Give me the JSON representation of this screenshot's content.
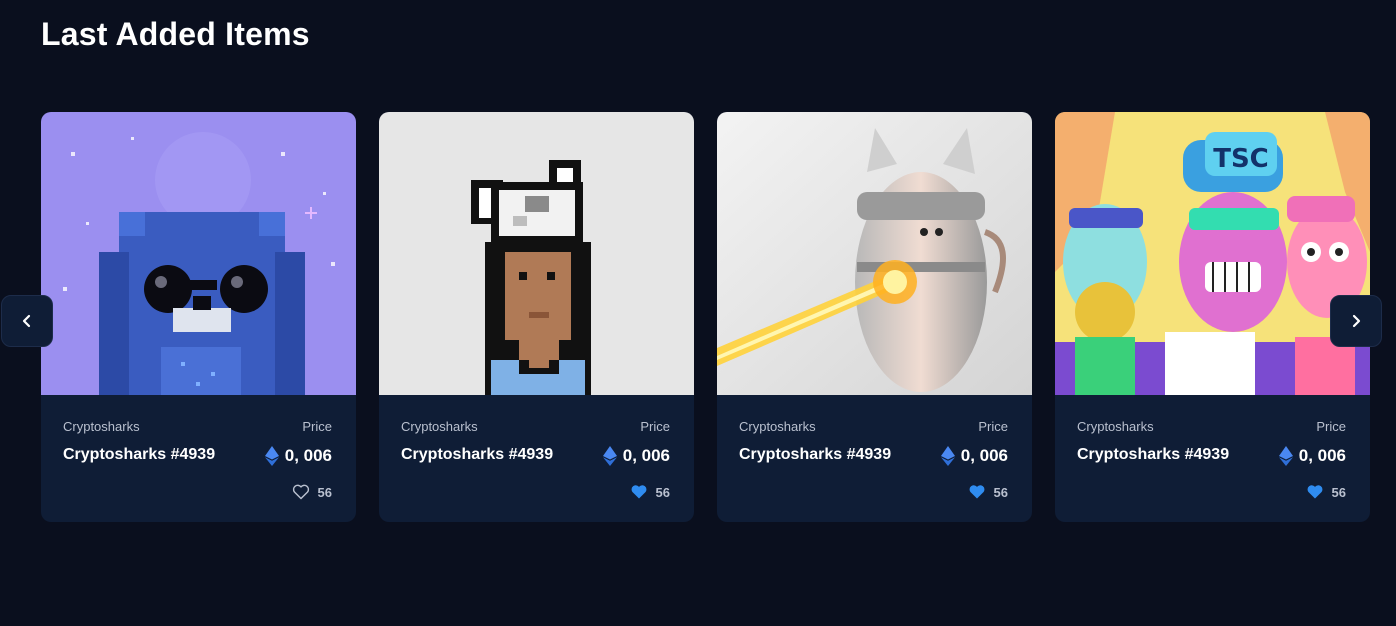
{
  "section": {
    "title": "Last Added Items"
  },
  "carousel": {
    "prev_icon": "chevron-left-icon",
    "next_icon": "chevron-right-icon",
    "cards": [
      {
        "collection": "Cryptosharks",
        "price_label": "Price",
        "name": "Cryptosharks #4939",
        "price": "0, 006",
        "currency_icon": "ethereum-icon",
        "likes": "56",
        "liked": false,
        "art": "purple-owl-pixel-art"
      },
      {
        "collection": "Cryptosharks",
        "price_label": "Price",
        "name": "Cryptosharks #4939",
        "price": "0, 006",
        "currency_icon": "ethereum-icon",
        "likes": "56",
        "liked": true,
        "art": "pixel-girl-with-cat-hat"
      },
      {
        "collection": "Cryptosharks",
        "price_label": "Price",
        "name": "Cryptosharks #4939",
        "price": "0, 006",
        "currency_icon": "ethereum-icon",
        "likes": "56",
        "liked": true,
        "art": "robot-cat-laser"
      },
      {
        "collection": "Cryptosharks",
        "price_label": "Price",
        "name": "Cryptosharks #4939",
        "price": "0, 006",
        "currency_icon": "ethereum-icon",
        "likes": "56",
        "liked": true,
        "art": "colorful-zombie-crew"
      }
    ]
  },
  "colors": {
    "background": "#0a0f1e",
    "card": "#0f1d36",
    "accent": "#2f8cf0",
    "muted_text": "#b9c0cf"
  }
}
